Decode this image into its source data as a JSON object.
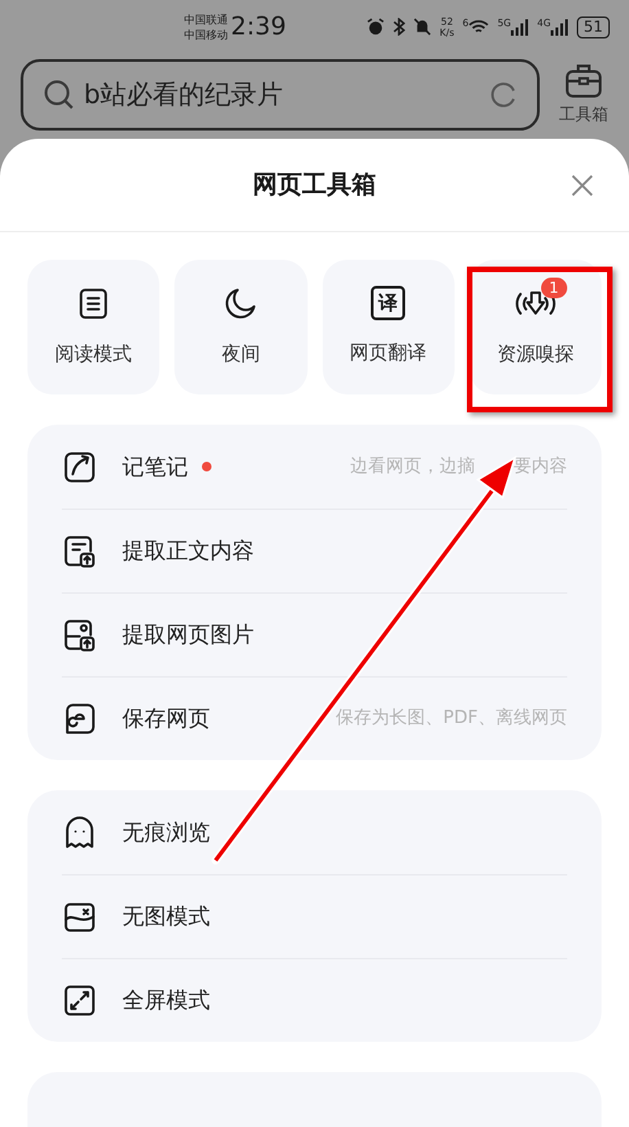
{
  "status_bar": {
    "carriers": [
      "中国联通",
      "中国移动"
    ],
    "time": "2:39",
    "speed": "52",
    "speed_unit": "K/s",
    "wifi_band": "6",
    "network_1": "5G",
    "network_2": "4G",
    "battery": "51"
  },
  "search": {
    "value": "b站必看的纪录片"
  },
  "toolbox_button": {
    "label": "工具箱"
  },
  "sheet": {
    "title": "网页工具箱"
  },
  "tools": [
    {
      "label": "阅读模式",
      "highlighted": false
    },
    {
      "label": "夜间",
      "highlighted": false
    },
    {
      "label": "网页翻译",
      "icon_text": "译",
      "highlighted": false
    },
    {
      "label": "资源嗅探",
      "badge": "1",
      "highlighted": true
    }
  ],
  "groups": [
    {
      "items": [
        {
          "label": "记笔记",
          "dot": true,
          "hint_parts": [
            "边看网页，边摘",
            "要内容"
          ]
        },
        {
          "label": "提取正文内容",
          "dot": false
        },
        {
          "label": "提取网页图片",
          "dot": false
        },
        {
          "label": "保存网页",
          "dot": false,
          "hint_parts": [
            "保存为长图、PDF、离线网页"
          ]
        }
      ]
    },
    {
      "items": [
        {
          "label": "无痕浏览",
          "dot": false
        },
        {
          "label": "无图模式",
          "dot": false
        },
        {
          "label": "全屏模式",
          "dot": false
        }
      ]
    }
  ]
}
